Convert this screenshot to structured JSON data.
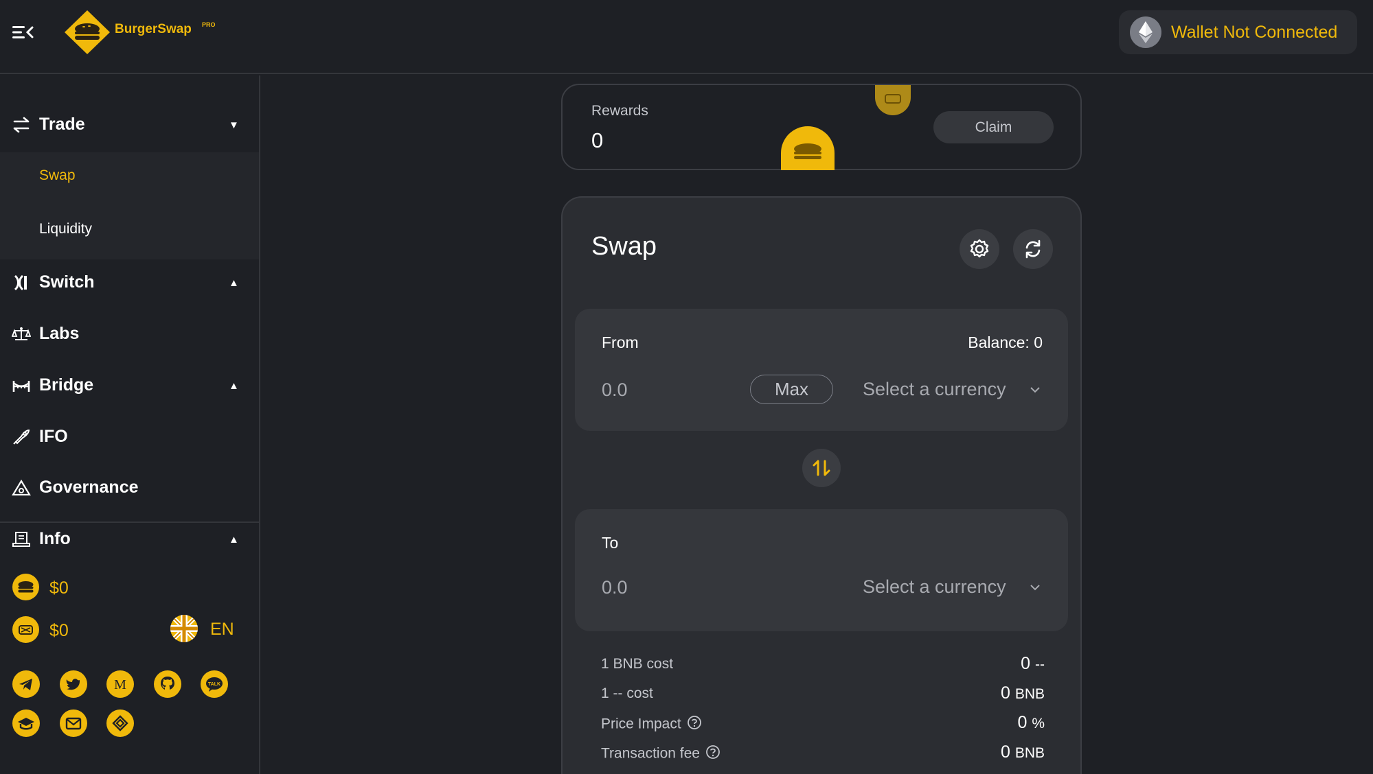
{
  "app": {
    "brand": "BurgerSwap",
    "brand_tag": "PRO"
  },
  "header": {
    "wallet_label": "Wallet Not Connected"
  },
  "sidebar": {
    "trade": {
      "label": "Trade",
      "caret": "▼"
    },
    "trade_sub": [
      {
        "label": "Swap",
        "active": true
      },
      {
        "label": "Liquidity",
        "active": false
      }
    ],
    "switch": {
      "label": "Switch",
      "caret": "▲"
    },
    "labs": {
      "label": "Labs"
    },
    "bridge": {
      "label": "Bridge",
      "caret": "▲"
    },
    "ifo": {
      "label": "IFO"
    },
    "governance": {
      "label": "Governance"
    },
    "info": {
      "label": "Info",
      "caret": "▲"
    },
    "prices": [
      {
        "value": "$0"
      },
      {
        "value": "$0"
      }
    ],
    "language": "EN",
    "socials": [
      "telegram-icon",
      "twitter-icon",
      "medium-icon",
      "github-icon",
      "kakaotalk-icon",
      "docs-icon",
      "email-icon",
      "binance-icon"
    ]
  },
  "rewards": {
    "label": "Rewards",
    "value": "0",
    "claim_label": "Claim"
  },
  "swap": {
    "title": "Swap",
    "from": {
      "label": "From",
      "balance": "Balance: 0",
      "amount_placeholder": "0.0",
      "max_label": "Max",
      "currency_label": "Select a currency"
    },
    "to": {
      "label": "To",
      "amount_placeholder": "0.0",
      "currency_label": "Select a currency"
    },
    "details": [
      {
        "label": "1 BNB cost",
        "value": "0",
        "unit": "--"
      },
      {
        "label": "1 -- cost",
        "value": "0",
        "unit": "BNB"
      },
      {
        "label": "Price Impact",
        "value": "0",
        "unit": "%"
      },
      {
        "label": "Transaction fee",
        "value": "0",
        "unit": "BNB"
      }
    ]
  },
  "colors": {
    "accent": "#f0b90b",
    "background": "#1e2025",
    "card": "#2b2d32",
    "panel": "#35373c"
  }
}
